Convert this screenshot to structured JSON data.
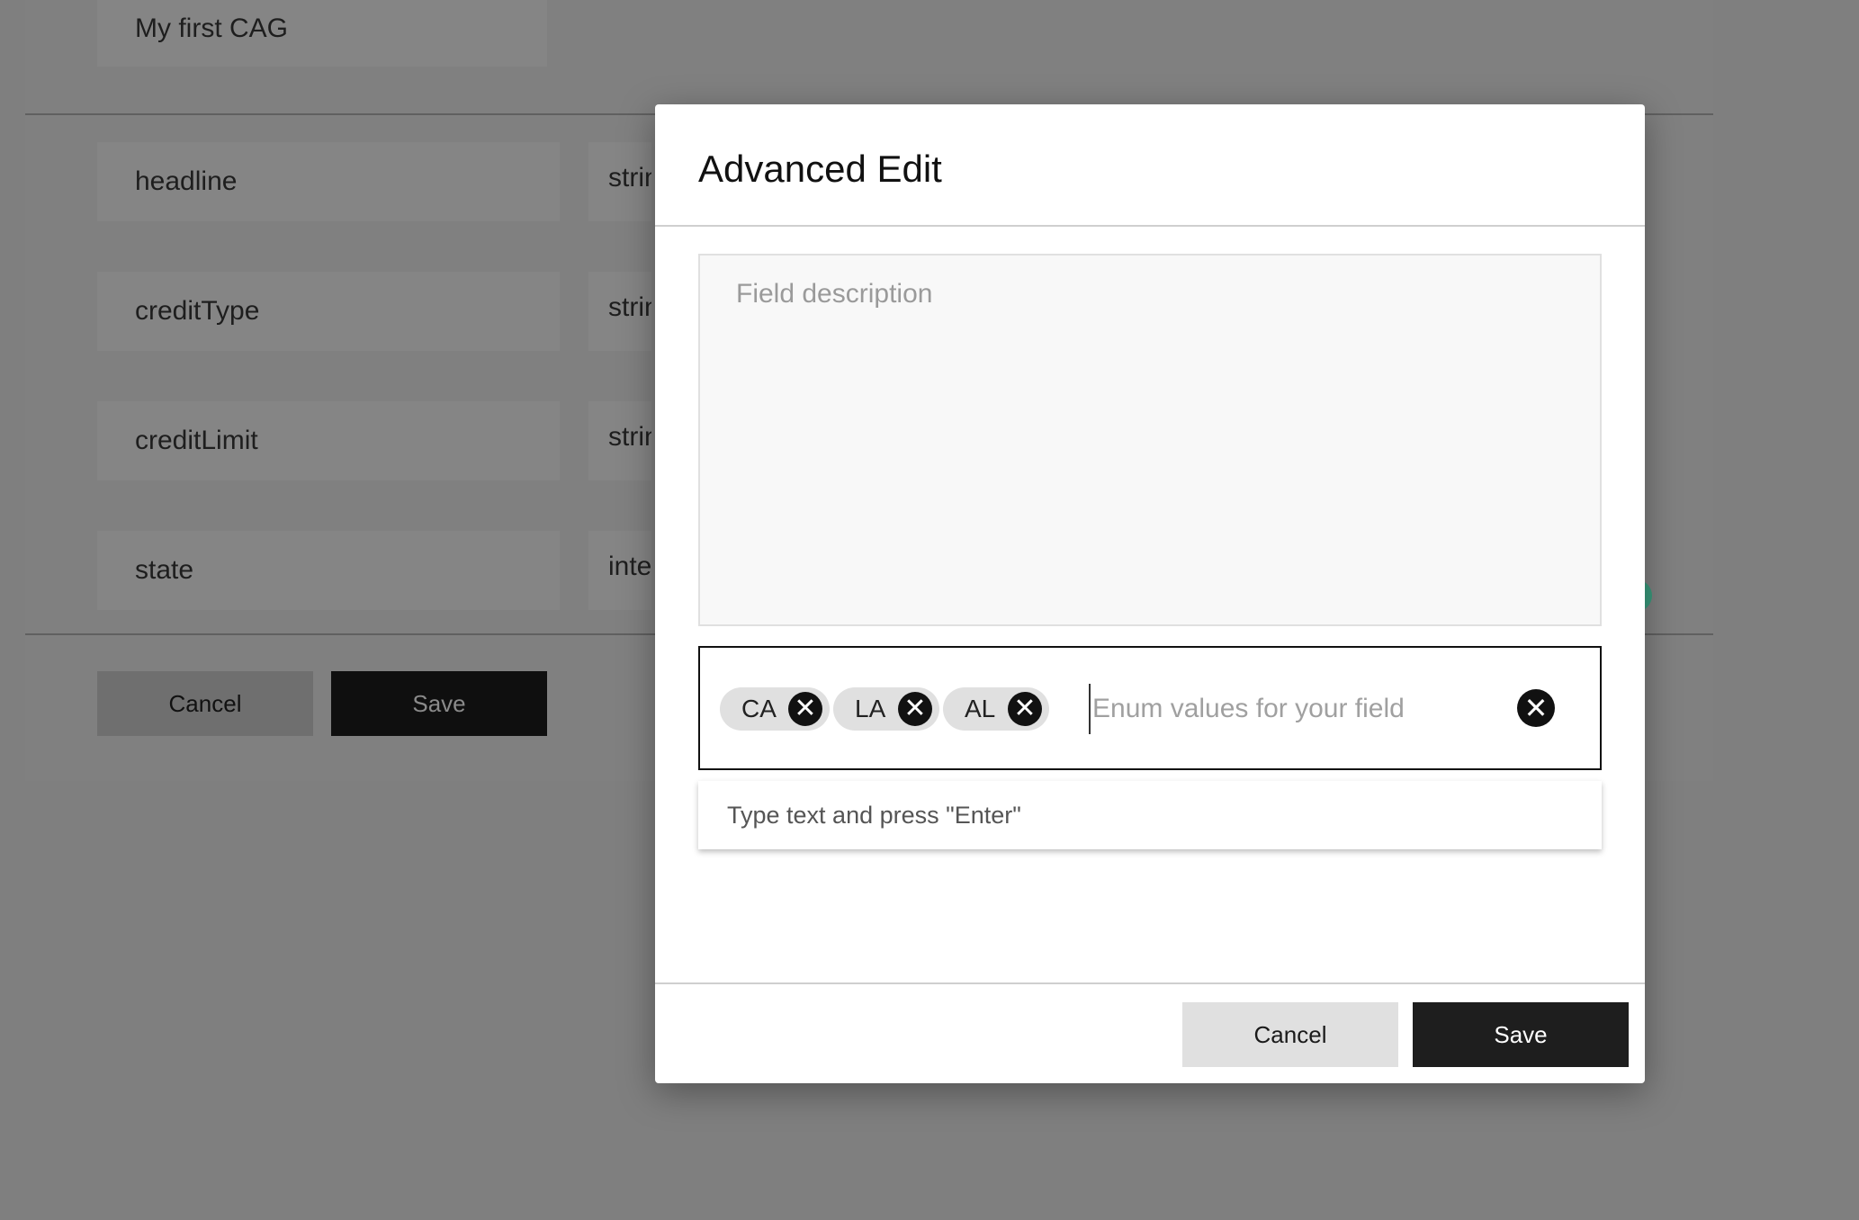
{
  "background": {
    "cag_name": "My first CAG",
    "fields": [
      {
        "name": "headline",
        "type": "string"
      },
      {
        "name": "creditType",
        "type": "string"
      },
      {
        "name": "creditLimit",
        "type": "string"
      },
      {
        "name": "state",
        "type": "integer"
      }
    ],
    "cancel_label": "Cancel",
    "save_label": "Save"
  },
  "modal": {
    "title": "Advanced Edit",
    "description_placeholder": "Field description",
    "enum": {
      "chips": [
        "CA",
        "LA",
        "AL"
      ],
      "remove_glyph": "✕",
      "placeholder": "Enum values for your field",
      "clear_glyph": "✕",
      "hint": "Type text and press \"Enter\""
    },
    "cancel_label": "Cancel",
    "save_label": "Save"
  }
}
